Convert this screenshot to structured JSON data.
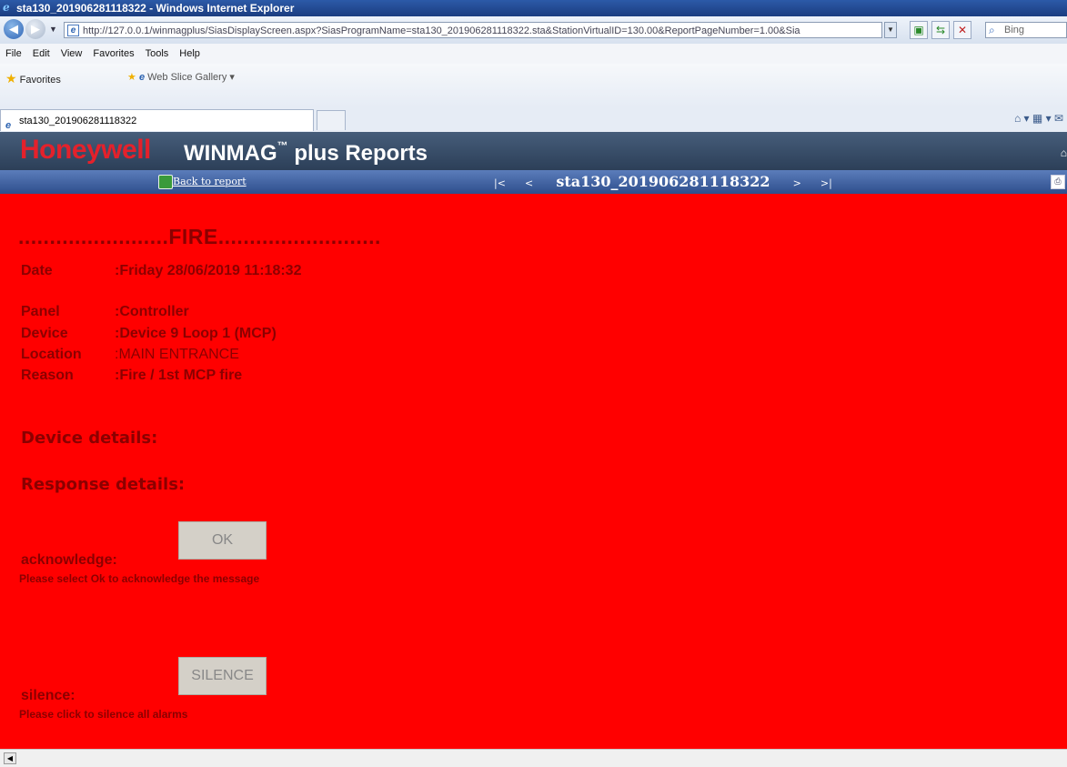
{
  "window": {
    "title": "sta130_201906281118322 - Windows Internet Explorer"
  },
  "browser": {
    "address": "http://127.0.0.1/winmagplus/SiasDisplayScreen.aspx?SiasProgramName=sta130_201906281118322.sta&StationVirtualID=130.00&ReportPageNumber=1.00&Sia",
    "search_placeholder": "Bing",
    "menu": [
      "File",
      "Edit",
      "View",
      "Favorites",
      "Tools",
      "Help"
    ],
    "favorites_label": "Favorites",
    "web_slice_label": "Web Slice Gallery ▾",
    "tab_title": "sta130_201906281118322"
  },
  "app": {
    "brand": "Honeywell",
    "title": "WINMAG",
    "title_mark": "™",
    "title_suffix": " plus Reports",
    "back_link": "Back to report",
    "pager": {
      "first": "|<",
      "prev": "<",
      "name": "sta130_201906281118322",
      "next": ">",
      "last": ">|"
    }
  },
  "alarm": {
    "heading": "........................FIRE..........................",
    "date_label": "Date",
    "date_value": ":Friday 28/06/2019 11:18:32",
    "panel_label": "Panel",
    "panel_value": ":Controller",
    "device_label": "Device",
    "device_value": ":Device 9 Loop 1 (MCP)",
    "location_label": "Location",
    "location_value": ":MAIN ENTRANCE",
    "reason_label": "Reason",
    "reason_value": ":Fire / 1st MCP fire"
  },
  "sections": {
    "device_details": "Device details:",
    "response_details": "Response details:"
  },
  "actions": {
    "acknowledge_label": "acknowledge:",
    "ok_button": "OK",
    "acknowledge_hint": "Please select Ok to acknowledge the message",
    "silence_label": "silence:",
    "silence_button": "SILENCE",
    "silence_hint": "Please click to silence all alarms"
  },
  "colors": {
    "background": "#ff0000",
    "text": "#8b0000",
    "brand": "#e4212b"
  }
}
